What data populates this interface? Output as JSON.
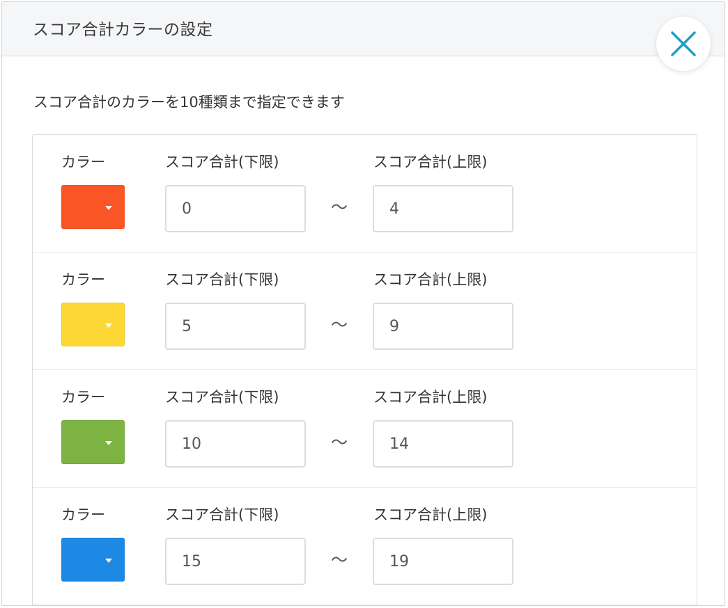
{
  "modal": {
    "title": "スコア合計カラーの設定",
    "close_icon": "close-x-icon",
    "close_icon_color": "#1aa0c8",
    "description": "スコア合計のカラーを10種類まで指定できます"
  },
  "rows": [
    {
      "color_label": "カラー",
      "lower_label": "スコア合計(下限)",
      "upper_label": "スコア合計(上限)",
      "color": "#fa5525",
      "lower_value": "0",
      "separator": "〜",
      "upper_value": "4"
    },
    {
      "color_label": "カラー",
      "lower_label": "スコア合計(下限)",
      "upper_label": "スコア合計(上限)",
      "color": "#fdd835",
      "lower_value": "5",
      "separator": "〜",
      "upper_value": "9"
    },
    {
      "color_label": "カラー",
      "lower_label": "スコア合計(下限)",
      "upper_label": "スコア合計(上限)",
      "color": "#7cb342",
      "lower_value": "10",
      "separator": "〜",
      "upper_value": "14"
    },
    {
      "color_label": "カラー",
      "lower_label": "スコア合計(下限)",
      "upper_label": "スコア合計(上限)",
      "color": "#1e88e5",
      "lower_value": "15",
      "separator": "〜",
      "upper_value": "19"
    }
  ]
}
